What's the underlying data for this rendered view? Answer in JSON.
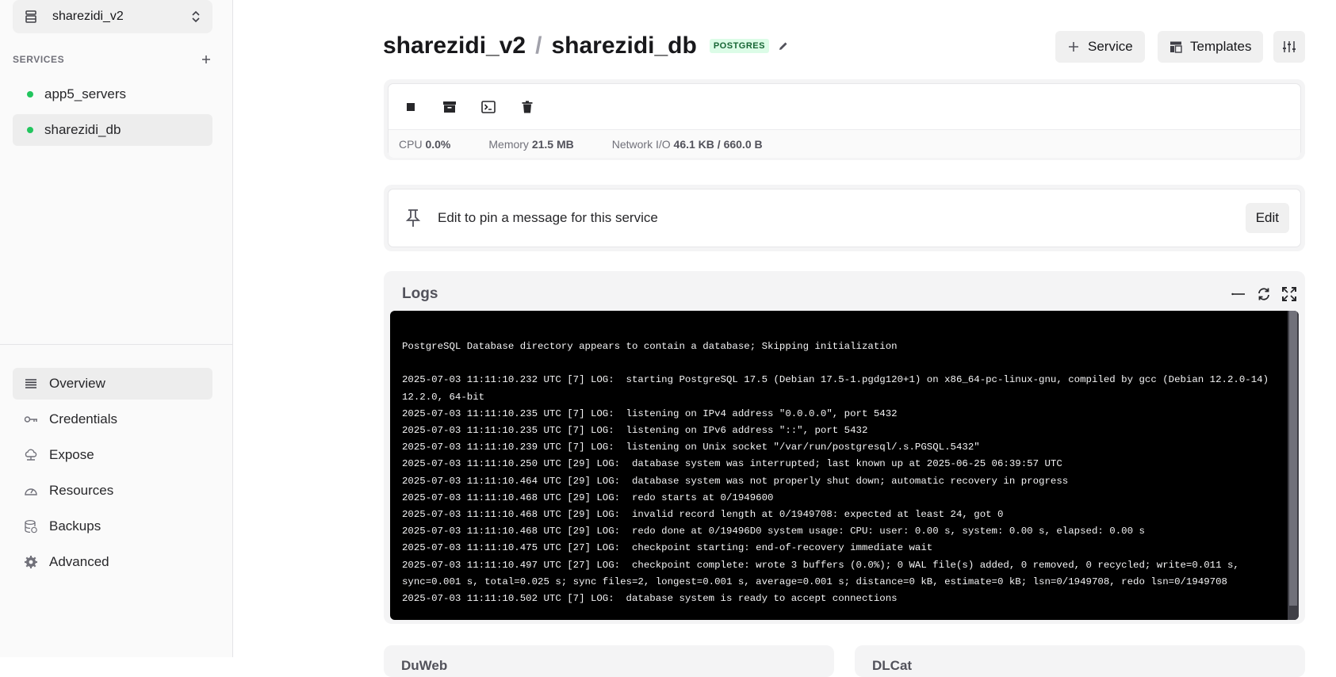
{
  "sidebar": {
    "project_name": "sharezidi_v2",
    "services_label": "SERVICES",
    "services": [
      {
        "name": "app5_servers",
        "status": "running",
        "active": false
      },
      {
        "name": "sharezidi_db",
        "status": "running",
        "active": true
      }
    ],
    "nav": [
      {
        "label": "Overview",
        "icon": "list-icon",
        "active": true
      },
      {
        "label": "Credentials",
        "icon": "key-icon",
        "active": false
      },
      {
        "label": "Expose",
        "icon": "cloud-icon",
        "active": false
      },
      {
        "label": "Resources",
        "icon": "gauge-icon",
        "active": false
      },
      {
        "label": "Backups",
        "icon": "database-icon",
        "active": false
      },
      {
        "label": "Advanced",
        "icon": "gear-icon",
        "active": false
      }
    ]
  },
  "header": {
    "project": "sharezidi_v2",
    "separator": "/",
    "service": "sharezidi_db",
    "badge": "POSTGRES",
    "service_button": "Service",
    "templates_button": "Templates"
  },
  "metrics": {
    "cpu_label": "CPU",
    "cpu_value": "0.0%",
    "memory_label": "Memory",
    "memory_value": "21.5 MB",
    "network_label": "Network I/O",
    "network_value": "46.1 KB / 660.0 B"
  },
  "pin": {
    "text": "Edit to pin a message for this service",
    "edit_button": "Edit"
  },
  "logs": {
    "title": "Logs",
    "lines": [
      "PostgreSQL Database directory appears to contain a database; Skipping initialization",
      "",
      "2025-07-03 11:11:10.232 UTC [7] LOG:  starting PostgreSQL 17.5 (Debian 17.5-1.pgdg120+1) on x86_64-pc-linux-gnu, compiled by gcc (Debian 12.2.0-14) 12.2.0, 64-bit",
      "2025-07-03 11:11:10.235 UTC [7] LOG:  listening on IPv4 address \"0.0.0.0\", port 5432",
      "2025-07-03 11:11:10.235 UTC [7] LOG:  listening on IPv6 address \"::\", port 5432",
      "2025-07-03 11:11:10.239 UTC [7] LOG:  listening on Unix socket \"/var/run/postgresql/.s.PGSQL.5432\"",
      "2025-07-03 11:11:10.250 UTC [29] LOG:  database system was interrupted; last known up at 2025-06-25 06:39:57 UTC",
      "2025-07-03 11:11:10.464 UTC [29] LOG:  database system was not properly shut down; automatic recovery in progress",
      "2025-07-03 11:11:10.468 UTC [29] LOG:  redo starts at 0/1949600",
      "2025-07-03 11:11:10.468 UTC [29] LOG:  invalid record length at 0/1949708: expected at least 24, got 0",
      "2025-07-03 11:11:10.468 UTC [29] LOG:  redo done at 0/19496D0 system usage: CPU: user: 0.00 s, system: 0.00 s, elapsed: 0.00 s",
      "2025-07-03 11:11:10.475 UTC [27] LOG:  checkpoint starting: end-of-recovery immediate wait",
      "2025-07-03 11:11:10.497 UTC [27] LOG:  checkpoint complete: wrote 3 buffers (0.0%); 0 WAL file(s) added, 0 removed, 0 recycled; write=0.011 s, sync=0.001 s, total=0.025 s; sync files=2, longest=0.001 s, average=0.001 s; distance=0 kB, estimate=0 kB; lsn=0/1949708, redo lsn=0/1949708",
      "2025-07-03 11:11:10.502 UTC [7] LOG:  database system is ready to accept connections"
    ]
  },
  "bottom_cards": [
    "DuWeb",
    "DLCat"
  ]
}
